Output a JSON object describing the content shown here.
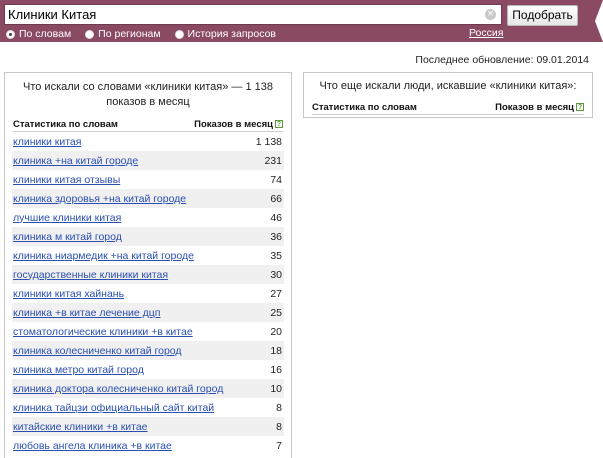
{
  "search": {
    "query": "Клиники Китая",
    "submit_label": "Подобрать",
    "modes": [
      {
        "label": "По словам",
        "checked": true
      },
      {
        "label": "По регионам",
        "checked": false
      },
      {
        "label": "История запросов",
        "checked": false
      }
    ],
    "region": "Россия"
  },
  "last_update": "Последнее обновление: 09.01.2014",
  "left_panel": {
    "title": "Что искали со словами «клиники китая» — 1 138 показов в месяц",
    "col_keyword": "Статистика по словам",
    "col_count": "Показов в месяц",
    "rows": [
      {
        "keyword": "клиники китая",
        "count": "1 138"
      },
      {
        "keyword": "клиника +на китай городе",
        "count": "231"
      },
      {
        "keyword": "клиники китая отзывы",
        "count": "74"
      },
      {
        "keyword": "клиника здоровья +на китай городе",
        "count": "66"
      },
      {
        "keyword": "лучшие клиники китая",
        "count": "46"
      },
      {
        "keyword": "клиника м китай город",
        "count": "36"
      },
      {
        "keyword": "клиника ниармедик +на китай городе",
        "count": "35"
      },
      {
        "keyword": "государственные клиники китая",
        "count": "30"
      },
      {
        "keyword": "клиники китая хайнань",
        "count": "27"
      },
      {
        "keyword": "клиника +в китае лечение дцп",
        "count": "25"
      },
      {
        "keyword": "стоматологические клиники +в китае",
        "count": "20"
      },
      {
        "keyword": "клиника колесниченко китай город",
        "count": "18"
      },
      {
        "keyword": "клиника метро китай город",
        "count": "16"
      },
      {
        "keyword": "клиника доктора колесниченко китай город",
        "count": "10"
      },
      {
        "keyword": "клиника тайцзи официальный сайт китай",
        "count": "8"
      },
      {
        "keyword": "китайские клиники +в китае",
        "count": "8"
      },
      {
        "keyword": "любовь ангела клиника +в китае",
        "count": "7"
      }
    ]
  },
  "right_panel": {
    "title": "Что еще искали люди, искавшие «клиники китая»:",
    "col_keyword": "Статистика по словам",
    "col_count": "Показов в месяц"
  },
  "icons": {
    "clear": "clear-icon",
    "help": "help-icon"
  },
  "colors": {
    "topbar": "#8a4a63",
    "link": "#2a4fb0",
    "help": "#5a9a3a"
  }
}
